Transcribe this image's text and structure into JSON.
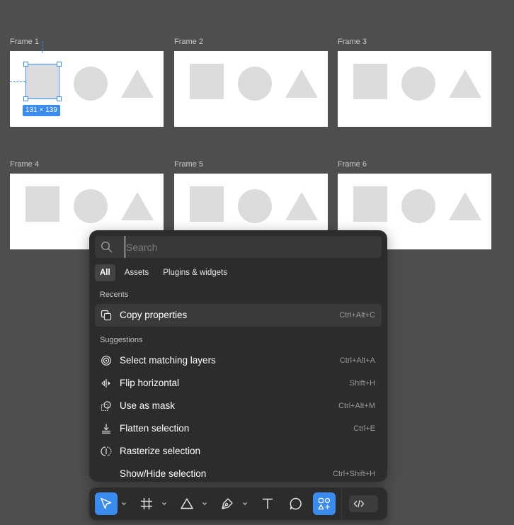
{
  "canvas": {
    "frames": [
      {
        "label": "Frame 1",
        "selected": true
      },
      {
        "label": "Frame 2"
      },
      {
        "label": "Frame 3"
      },
      {
        "label": "Frame 4"
      },
      {
        "label": "Frame 5"
      },
      {
        "label": "Frame 6"
      }
    ],
    "selection_size": "131 × 139"
  },
  "quick_actions": {
    "search": {
      "placeholder": "Search",
      "value": ""
    },
    "tabs": [
      {
        "label": "All",
        "active": true
      },
      {
        "label": "Assets"
      },
      {
        "label": "Plugins & widgets"
      }
    ],
    "recents_title": "Recents",
    "recents": [
      {
        "label": "Copy properties",
        "shortcut": "Ctrl+Alt+C",
        "icon": "copy-properties-icon"
      }
    ],
    "suggestions_title": "Suggestions",
    "suggestions": [
      {
        "label": "Select matching layers",
        "shortcut": "Ctrl+Alt+A",
        "icon": "target-icon"
      },
      {
        "label": "Flip horizontal",
        "shortcut": "Shift+H",
        "icon": "flip-horizontal-icon"
      },
      {
        "label": "Use as mask",
        "shortcut": "Ctrl+Alt+M",
        "icon": "mask-icon"
      },
      {
        "label": "Flatten selection",
        "shortcut": "Ctrl+E",
        "icon": "flatten-icon"
      },
      {
        "label": "Rasterize selection",
        "shortcut": "",
        "icon": "rasterize-icon"
      },
      {
        "label": "Show/Hide selection",
        "shortcut": "Ctrl+Shift+H",
        "icon": ""
      }
    ]
  },
  "toolbar": {
    "tools": [
      {
        "name": "move-tool",
        "icon": "cursor-icon",
        "active": true
      },
      {
        "name": "frame-tool",
        "icon": "frame-icon"
      },
      {
        "name": "shape-tool",
        "icon": "triangle-icon"
      },
      {
        "name": "pen-tool",
        "icon": "pen-icon"
      },
      {
        "name": "text-tool",
        "icon": "text-icon"
      },
      {
        "name": "comment-tool",
        "icon": "comment-icon"
      },
      {
        "name": "actions-tool",
        "icon": "actions-icon",
        "active": true
      }
    ],
    "dev_mode_icon": "code-icon"
  },
  "colors": {
    "canvas_bg": "#4e4e4e",
    "accent": "#3b8cf0",
    "panel_bg": "#2c2c2c",
    "shape_fill": "#dcdcdc"
  }
}
